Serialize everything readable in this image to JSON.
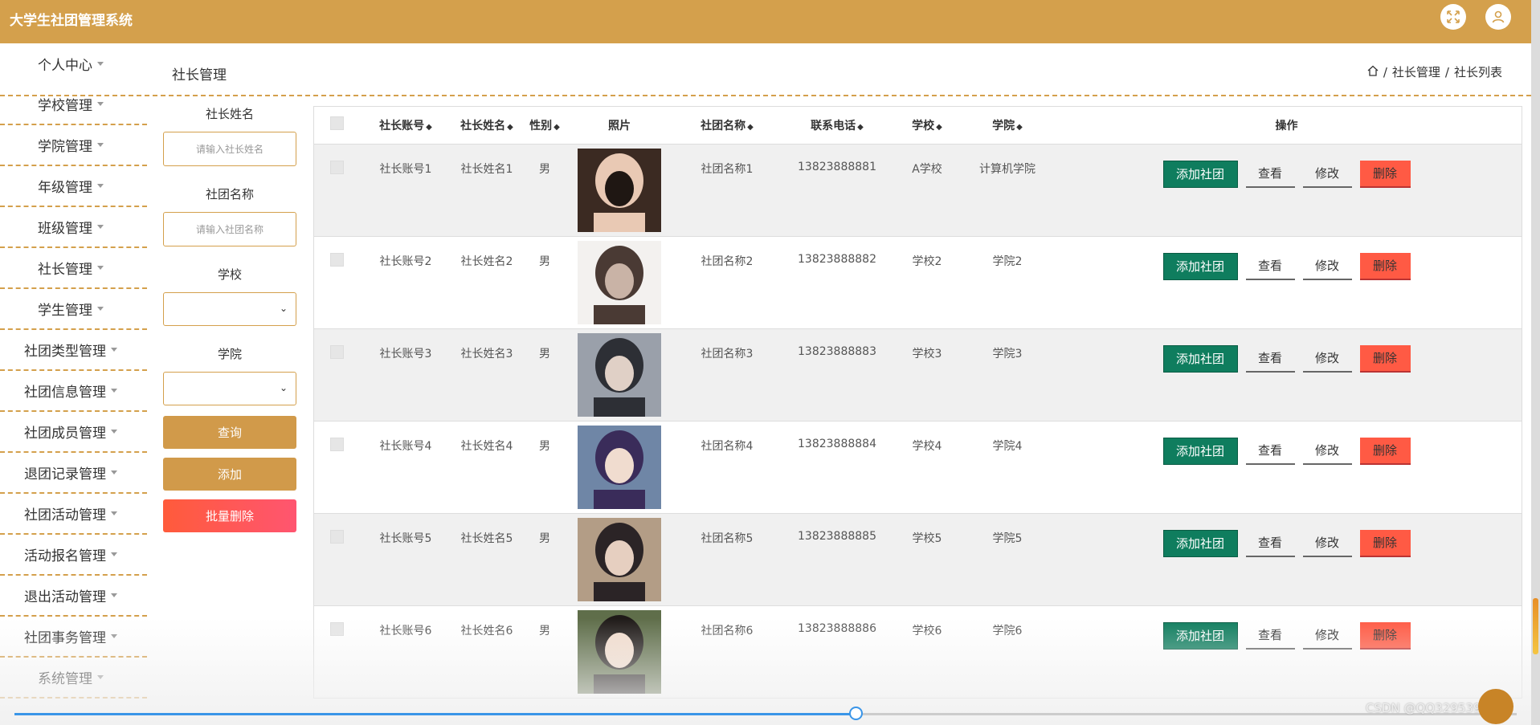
{
  "app": {
    "title": "大学生社团管理系统"
  },
  "topbar": {
    "fullscreen_icon": "fullscreen-icon",
    "user_icon": "user-icon"
  },
  "sidebar": {
    "items": [
      {
        "label": "个人中心"
      },
      {
        "label": "学校管理"
      },
      {
        "label": "学院管理"
      },
      {
        "label": "年级管理"
      },
      {
        "label": "班级管理"
      },
      {
        "label": "社长管理"
      },
      {
        "label": "学生管理"
      },
      {
        "label": "社团类型管理"
      },
      {
        "label": "社团信息管理"
      },
      {
        "label": "社团成员管理"
      },
      {
        "label": "退团记录管理"
      },
      {
        "label": "社团活动管理"
      },
      {
        "label": "活动报名管理"
      },
      {
        "label": "退出活动管理"
      },
      {
        "label": "社团事务管理"
      },
      {
        "label": "系统管理"
      }
    ]
  },
  "header": {
    "page_title": "社长管理",
    "breadcrumb": {
      "home_icon": "home-icon",
      "sep": "/",
      "level1": "社长管理",
      "level2": "社长列表"
    }
  },
  "filters": {
    "name_label": "社长姓名",
    "name_placeholder": "请输入社长姓名",
    "club_label": "社团名称",
    "club_placeholder": "请输入社团名称",
    "school_label": "学校",
    "school_value": "",
    "college_label": "学院",
    "college_value": "",
    "query_btn": "查询",
    "add_btn": "添加",
    "batch_delete_btn": "批量删除"
  },
  "table": {
    "columns": [
      "社长账号",
      "社长姓名",
      "性别",
      "照片",
      "社团名称",
      "联系电话",
      "学校",
      "学院",
      "操作"
    ],
    "sortable": [
      true,
      true,
      true,
      false,
      true,
      true,
      true,
      true,
      false
    ],
    "rows": [
      {
        "account": "社长账号1",
        "name": "社长姓名1",
        "gender": "男",
        "club": "社团名称1",
        "phone": "13823888881",
        "school": "A学校",
        "college": "计算机学院"
      },
      {
        "account": "社长账号2",
        "name": "社长姓名2",
        "gender": "男",
        "club": "社团名称2",
        "phone": "13823888882",
        "school": "学校2",
        "college": "学院2"
      },
      {
        "account": "社长账号3",
        "name": "社长姓名3",
        "gender": "男",
        "club": "社团名称3",
        "phone": "13823888883",
        "school": "学校3",
        "college": "学院3"
      },
      {
        "account": "社长账号4",
        "name": "社长姓名4",
        "gender": "男",
        "club": "社团名称4",
        "phone": "13823888884",
        "school": "学校4",
        "college": "学院4"
      },
      {
        "account": "社长账号5",
        "name": "社长姓名5",
        "gender": "男",
        "club": "社团名称5",
        "phone": "13823888885",
        "school": "学校5",
        "college": "学院5"
      },
      {
        "account": "社长账号6",
        "name": "社长姓名6",
        "gender": "男",
        "club": "社团名称6",
        "phone": "13823888886",
        "school": "学校6",
        "college": "学院6"
      }
    ],
    "ops": {
      "add_club": "添加社团",
      "view": "查看",
      "edit": "修改",
      "delete": "删除"
    }
  },
  "video": {
    "progress": 0.56
  },
  "watermark": "CSDN @QQ3295391197",
  "colors": {
    "brand": "#d4a04c",
    "danger": "#ff5a44",
    "success": "#0f7d5e",
    "progress": "#3a95e8"
  }
}
